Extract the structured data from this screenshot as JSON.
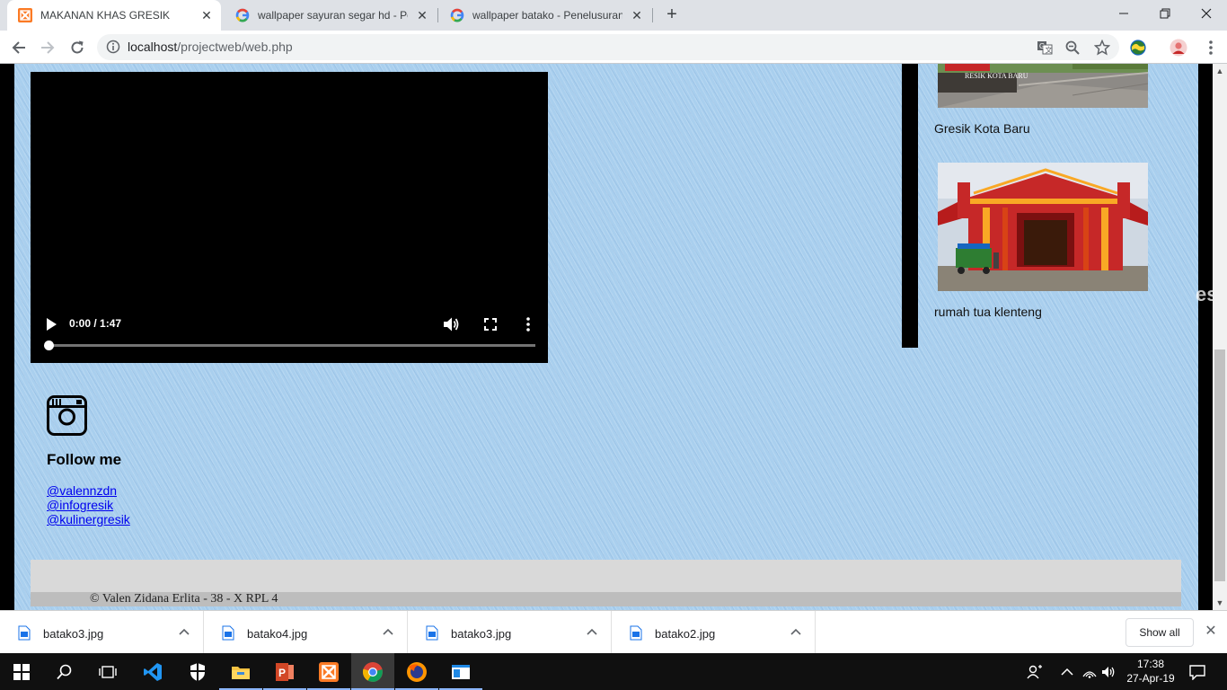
{
  "browser": {
    "tabs": [
      {
        "title": "MAKANAN KHAS GRESIK",
        "active": true,
        "favicon": "xampp-icon"
      },
      {
        "title": "wallpaper sayuran segar hd - Pen",
        "active": false,
        "favicon": "google-icon"
      },
      {
        "title": "wallpaper batako - Penelusuran G",
        "active": false,
        "favicon": "google-icon"
      }
    ],
    "address": {
      "host": "localhost",
      "path": "/projectweb/web.php"
    }
  },
  "page": {
    "video": {
      "time": "0:00 / 1:47",
      "progress": 0
    },
    "gallery": [
      {
        "caption": "Gresik Kota Baru",
        "sign_text": "RESIK KOTA BARU"
      },
      {
        "caption": "rumah tua klenteng"
      }
    ],
    "cut_text": "es",
    "follow": {
      "title": "Follow me",
      "links": [
        "@valennzdn",
        "@infogresik",
        "@kulinergresik"
      ]
    },
    "footer": "© Valen Zidana Erlita - 38 - X RPL 4"
  },
  "downloads": {
    "items": [
      "batako3.jpg",
      "batako4.jpg",
      "batako3.jpg",
      "batako2.jpg"
    ],
    "show_all": "Show all"
  },
  "taskbar": {
    "clock_time": "17:38",
    "clock_date": "27-Apr-19",
    "apps": [
      "start-icon",
      "search-icon",
      "task-view-icon",
      "vscode-icon",
      "security-icon",
      "file-explorer-icon",
      "powerpoint-icon",
      "xampp-icon",
      "chrome-icon",
      "firefox-icon",
      "app-window-icon"
    ]
  },
  "colors": {
    "accent": "#1a73e8",
    "page_bg": "#a9cfee",
    "xampp": "#fb7a24"
  }
}
